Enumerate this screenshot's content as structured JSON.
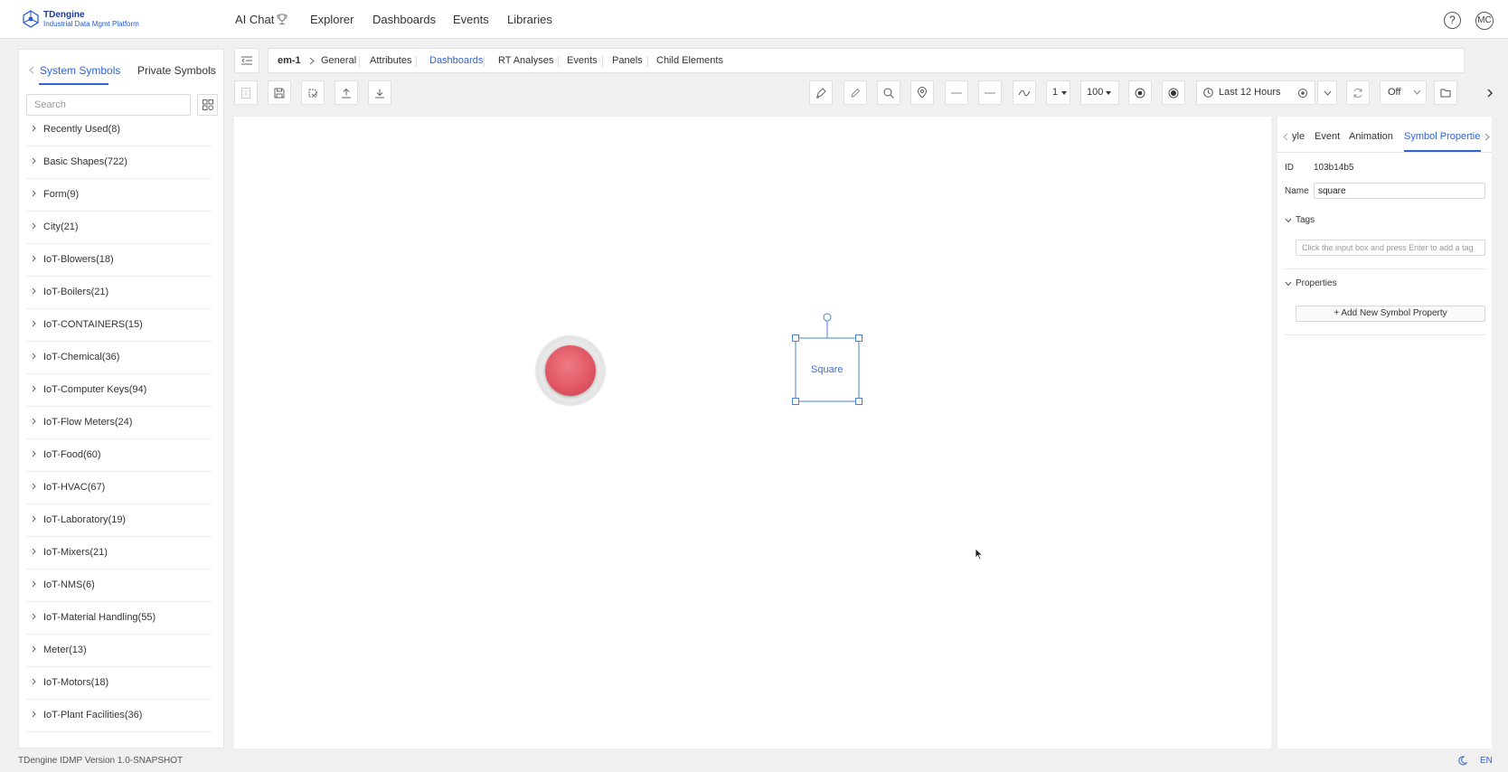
{
  "app": {
    "brand_name": "TDengine",
    "brand_tagline": "Industrial Data Mgmt Platform",
    "footer_version": "TDengine IDMP Version 1.0-SNAPSHOT",
    "language": "EN"
  },
  "topnav": {
    "items": [
      "AI Chat",
      "Explorer",
      "Dashboards",
      "Events",
      "Libraries"
    ],
    "help": "?",
    "avatar": "MC"
  },
  "symbols": {
    "tabs": [
      "System Symbols",
      "Private Symbols"
    ],
    "active_tab": "System Symbols",
    "search_placeholder": "Search",
    "categories": [
      "Recently Used(8)",
      "Basic Shapes(722)",
      "Form(9)",
      "City(21)",
      "IoT-Blowers(18)",
      "IoT-Boilers(21)",
      "IoT-CONTAINERS(15)",
      "IoT-Chemical(36)",
      "IoT-Computer Keys(94)",
      "IoT-Flow Meters(24)",
      "IoT-Food(60)",
      "IoT-HVAC(67)",
      "IoT-Laboratory(19)",
      "IoT-Mixers(21)",
      "IoT-NMS(6)",
      "IoT-Material Handling(55)",
      "Meter(13)",
      "IoT-Motors(18)",
      "IoT-Plant Facilities(36)"
    ]
  },
  "breadcrumb": {
    "root": "em-1",
    "tabs": [
      "General",
      "Attributes",
      "Dashboards",
      "RT Analyses",
      "Events",
      "Panels",
      "Child Elements"
    ],
    "active_tab": "Dashboards"
  },
  "toolbar": {
    "line_width": "1",
    "zoom": "100",
    "time_range": "Last 12 Hours",
    "refresh": "Off"
  },
  "canvas": {
    "square_label": "Square"
  },
  "properties": {
    "tabs": [
      "yle",
      "Event",
      "Animation",
      "Symbol Properties"
    ],
    "active_tab": "Symbol Properties",
    "id_label": "ID",
    "id_value": "103b14b5",
    "name_label": "Name",
    "name_value": "square",
    "tags_label": "Tags",
    "tags_placeholder": "Click the input box and press Enter to add a tag",
    "properties_label": "Properties",
    "add_button": "Add New Symbol Property"
  },
  "colors": {
    "accent": "#2f63d6",
    "button_red": "#e05562"
  }
}
